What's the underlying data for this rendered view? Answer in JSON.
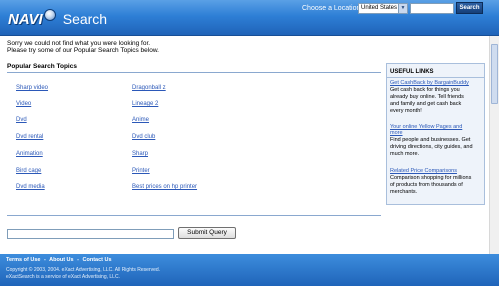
{
  "header": {
    "logo_text": "NAVI",
    "logo_sub": "Search",
    "location_label": "Choose a Location:",
    "location_value": "United States",
    "search_value": "",
    "search_button": "Search"
  },
  "messages": {
    "line1": "Sorry we could not find what you were looking for.",
    "line2": "Please try some of our Popular Search Topics below."
  },
  "topics": {
    "title": "Popular Search Topics",
    "left": [
      "Sharp video",
      "Video",
      "Dvd",
      "Dvd rental",
      "Animation",
      "Bird cage",
      "Dvd media"
    ],
    "right": [
      "Dragonball z",
      "Lineage 2",
      "Anime",
      "Dvd club",
      "Sharp",
      "Printer",
      "Best prices on hp printer"
    ]
  },
  "sidebar": {
    "title": "USEFUL LINKS",
    "items": [
      {
        "link": "Get CashBack by BargainBuddy",
        "desc": [
          "Get cash back for things you",
          "already buy online. Tell friends",
          "and family and get cash back",
          "every month!"
        ]
      },
      {
        "link": "Your online Yellow Pages and",
        "link2": "more",
        "desc": [
          "Find people and businesses. Get",
          "driving directions, city guides, and",
          "much more."
        ]
      },
      {
        "link": "Related Price Comparisons",
        "desc": [
          "Comparison shopping for millions",
          "of products from thousands of",
          "merchants."
        ]
      }
    ]
  },
  "form": {
    "query_value": "",
    "submit_label": "Submit Query"
  },
  "footer": {
    "links": [
      "Terms of Use",
      "About Us",
      "Contact Us"
    ],
    "separator": "-",
    "copyright1": "Copyright © 2003, 2004. eXact Advertising, LLC. All Rights Reserved.",
    "copyright2": "eXactSearch is a service of eXact Advertising, LLC."
  },
  "colors": {
    "header_blue": "#2e7fd6",
    "link_blue": "#2b58b8",
    "footer_blue": "#1f64b9"
  }
}
